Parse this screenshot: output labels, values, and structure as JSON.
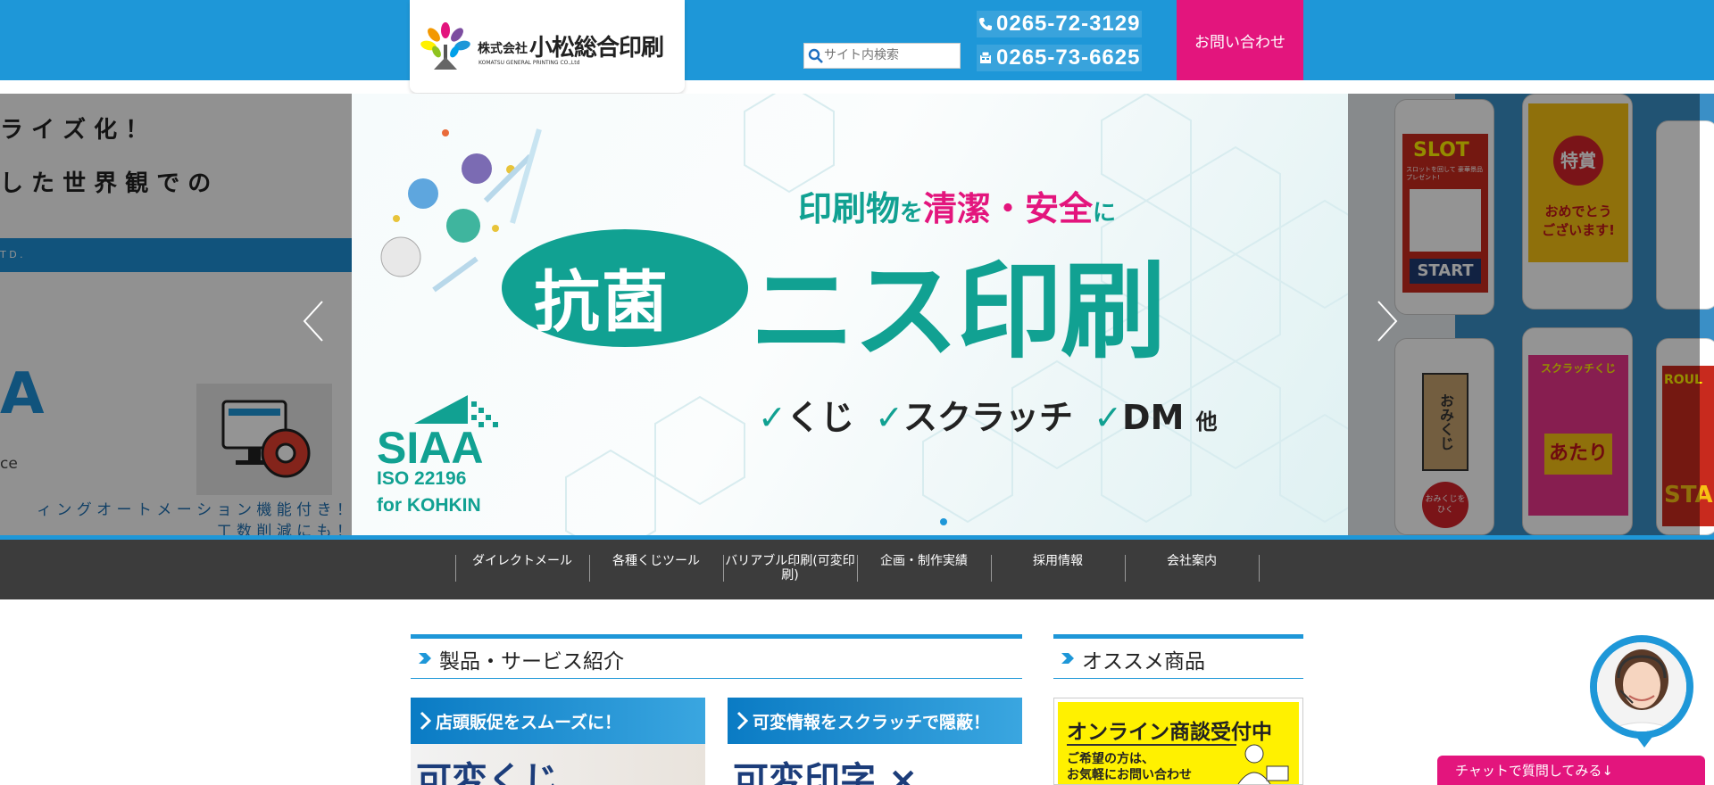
{
  "header": {
    "company_prefix": "株式会社",
    "company_name": "小松総合印刷",
    "company_en": "KOMATSU GENERAL PRINTING CO.,Ltd",
    "search_placeholder": "サイト内検索",
    "phone": "0265-72-3129",
    "fax": "0265-73-6625",
    "contact_label": "お問い合わせ"
  },
  "slider": {
    "left_slide": {
      "line1": "ラ イ ズ 化 ！",
      "line2": "し た 世 界 観 で の",
      "band_text": "T D .",
      "letter_a": "A",
      "ce": "ce",
      "bottom1": "ィ ン グ オ ー ト メ ー シ ョ ン 機 能 付 き ！",
      "bottom2": "工 数 削 減 に も ！"
    },
    "main_slide": {
      "tagline_a": "印刷物",
      "tagline_b": "を",
      "tagline_c": "清潔・安全",
      "tagline_d": "に",
      "badge": "抗菌",
      "title": "ニス印刷",
      "check1": "くじ",
      "check2": "スクラッチ",
      "check3": "DM",
      "check_tail": "他",
      "siaa": "SIAA",
      "iso": "ISO 22196",
      "for_kohkin": "for KOHKIN"
    },
    "right_slide": {
      "slot": "SLOT",
      "slot_sub": "スロットを回して 豪華景品プレゼント!",
      "start": "START",
      "tokushou": "特賞",
      "omedeto": "おめでとう ございます!",
      "omikuji": "おみくじ",
      "hiku": "おみくじを ひく",
      "scratch": "スクラッチくじ",
      "atari": "あたり",
      "roulette": "ROUL",
      "sta": "STA"
    },
    "prev_label": "previous",
    "next_label": "next"
  },
  "nav": {
    "items": [
      {
        "label": "ダイレクトメール"
      },
      {
        "label": "各種くじツール"
      },
      {
        "label": "バリアブル印刷(可変印刷)"
      },
      {
        "label": "企画・制作実績"
      },
      {
        "label": "採用情報"
      },
      {
        "label": "会社案内"
      }
    ]
  },
  "sections": {
    "products_title": "製品・サービス紹介",
    "recommended_title": "オススメ商品"
  },
  "cards": [
    {
      "head": "店頭販促をスムーズに！",
      "body": "可変くじ"
    },
    {
      "head": "可変情報をスクラッチで隠蔽！",
      "body": "可変印字 ×"
    }
  ],
  "recommended": {
    "title": "オンライン商談受付中",
    "sub1": "ご希望の方は、",
    "sub2": "お気軽にお問い合わせ"
  },
  "chat": {
    "button_label": "チャットで質問してみる↓"
  },
  "colors": {
    "brand_blue": "#1e97d8",
    "accent_pink": "#e3157d",
    "teal": "#11a192",
    "nav_bg": "#3c3c3c"
  }
}
